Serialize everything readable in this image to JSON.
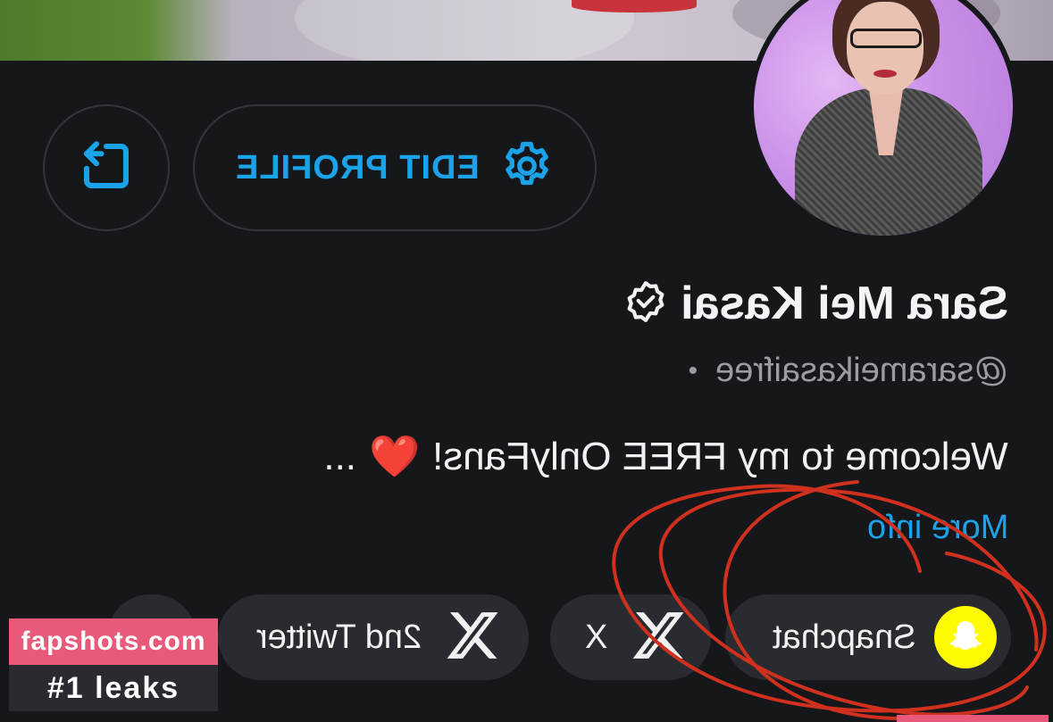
{
  "profile": {
    "name": "Sara Mei Kasai",
    "handle": "@sarameikasaifree",
    "separator": "•",
    "bio": "Welcome to my FREE OnlyFans!",
    "bio_emoji": "❤️",
    "bio_ellipsis": "...",
    "more_info": "More info"
  },
  "actions": {
    "edit_profile": "EDIT PROFILE",
    "share_icon": "share-icon",
    "settings_icon": "gear-icon"
  },
  "links": [
    {
      "label": "Snapchat",
      "icon": "snapchat-icon"
    },
    {
      "label": "X",
      "icon": "x-logo-icon"
    },
    {
      "label": "2nd Twitter",
      "icon": "x-logo-icon"
    }
  ],
  "watermark": {
    "site": "fapshots.com",
    "tagline": "#1 leaks"
  },
  "colors": {
    "background": "#16171b",
    "accent": "#1aa3e8",
    "pill": "#2a2b31",
    "snapchat": "#fffc00",
    "annotation": "#d0301e"
  }
}
